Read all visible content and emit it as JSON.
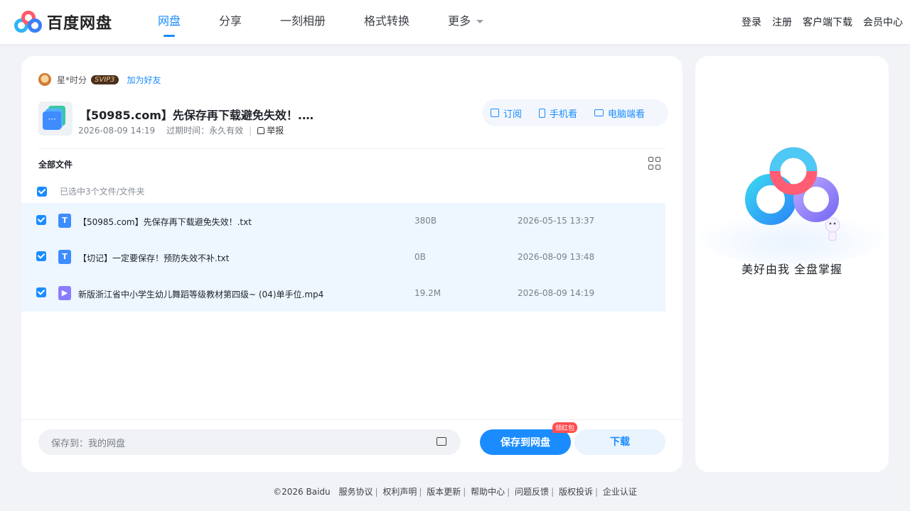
{
  "header": {
    "brand": "百度网盘",
    "nav": [
      {
        "label": "网盘"
      },
      {
        "label": "分享"
      },
      {
        "label": "一刻相册"
      },
      {
        "label": "格式转换"
      },
      {
        "label": "更多"
      }
    ],
    "links": [
      "登录",
      "注册",
      "客户端下载",
      "会员中心"
    ]
  },
  "share": {
    "owner_name": "星*时分",
    "vip": "SVIP3",
    "add_friend": "加为好友",
    "title": "【50985.com】先保存再下载避免失效！.…",
    "created": "2026-08-09 14:19",
    "expire_label": "过期时间：永久有效",
    "report": "举报",
    "actions": {
      "subscribe": "订阅",
      "mobile": "手机看",
      "desktop": "电脑端看"
    }
  },
  "files": {
    "section_title": "全部文件",
    "selected_text": "已选中3个文件/文件夹",
    "rows": [
      {
        "icon": "T",
        "name": "【50985.com】先保存再下载避免失效！.txt",
        "size": "380B",
        "date": "2026-05-15 13:37"
      },
      {
        "icon": "T",
        "name": "【切记】一定要保存！预防失效不补.txt",
        "size": "0B",
        "date": "2026-08-09 13:48"
      },
      {
        "icon": "▶",
        "name": "新版浙江省中小学生幼儿舞蹈等级教材第四级~ (04)单手位.mp4",
        "size": "19.2M",
        "date": "2026-08-09 14:19"
      }
    ]
  },
  "bottom": {
    "save_to": "保存到：我的网盘",
    "save_button": "保存到网盘",
    "badge": "领红包",
    "download_button": "下载"
  },
  "side": {
    "slogan": "美好由我  全盘掌握"
  },
  "footer": {
    "copyright": "©2026 Baidu",
    "links": [
      "服务协议",
      "权利声明",
      "版本更新",
      "帮助中心",
      "问题反馈",
      "版权投诉",
      "企业认证"
    ]
  }
}
